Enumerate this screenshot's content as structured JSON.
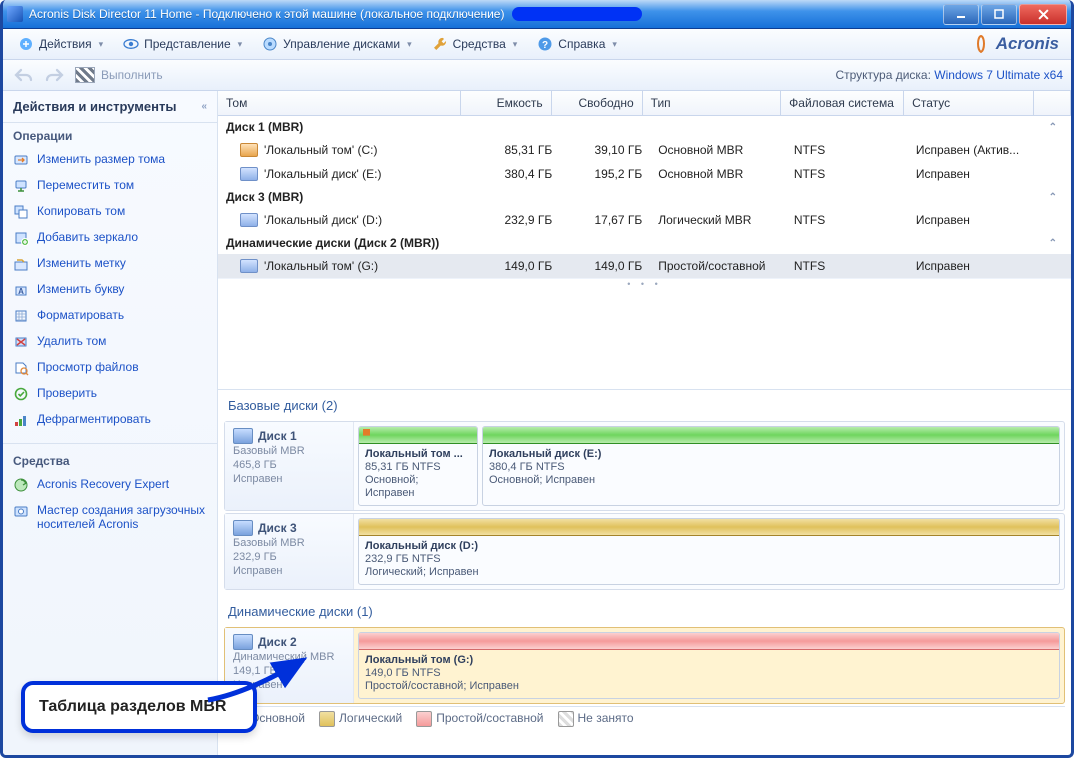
{
  "titlebar": {
    "title": "Acronis Disk Director 11 Home - Подключено к этой машине (локальное подключение)"
  },
  "menu": {
    "actions": "Действия",
    "view": "Представление",
    "diskmgmt": "Управление дисками",
    "tools": "Средства",
    "help": "Справка",
    "brand": "Acronis"
  },
  "toolbar": {
    "run": "Выполнить",
    "struct_label": "Структура диска:",
    "struct_value": "Windows 7 Ultimate x64"
  },
  "sidebar": {
    "title": "Действия и инструменты",
    "sec_ops": "Операции",
    "ops": [
      "Изменить размер тома",
      "Переместить том",
      "Копировать том",
      "Добавить зеркало",
      "Изменить метку",
      "Изменить букву",
      "Форматировать",
      "Удалить том",
      "Просмотр файлов",
      "Проверить",
      "Дефрагментировать"
    ],
    "sec_tools": "Средства",
    "tools": [
      "Acronis Recovery Expert",
      "Мастер создания загрузочных носителей Acronis"
    ]
  },
  "grid": {
    "headers": {
      "tom": "Том",
      "cap": "Емкость",
      "free": "Свободно",
      "type": "Тип",
      "fs": "Файловая система",
      "status": "Статус"
    },
    "groups": [
      {
        "title": "Диск 1 (MBR)",
        "rows": [
          {
            "name": "'Локальный том' (C:)",
            "cap": "85,31 ГБ",
            "free": "39,10 ГБ",
            "type": "Основной MBR",
            "fs": "NTFS",
            "status": "Исправен (Актив...",
            "boot": true
          },
          {
            "name": "'Локальный диск' (E:)",
            "cap": "380,4 ГБ",
            "free": "195,2 ГБ",
            "type": "Основной MBR",
            "fs": "NTFS",
            "status": "Исправен"
          }
        ]
      },
      {
        "title": "Диск 3 (MBR)",
        "rows": [
          {
            "name": "'Локальный диск' (D:)",
            "cap": "232,9 ГБ",
            "free": "17,67 ГБ",
            "type": "Логический MBR",
            "fs": "NTFS",
            "status": "Исправен"
          }
        ]
      },
      {
        "title": "Динамические диски (Диск 2 (MBR))",
        "rows": [
          {
            "name": "'Локальный том' (G:)",
            "cap": "149,0 ГБ",
            "free": "149,0 ГБ",
            "type": "Простой/составной",
            "fs": "NTFS",
            "status": "Исправен",
            "selected": true
          }
        ]
      }
    ]
  },
  "maps": {
    "basic_title": "Базовые диски (2)",
    "dynamic_title": "Динамические диски (1)",
    "disks": [
      {
        "name": "Диск 1",
        "type": "Базовый MBR",
        "size": "465,8 ГБ",
        "state": "Исправен",
        "parts": [
          {
            "name": "Локальный том ...",
            "sub": "85,31 ГБ NTFS",
            "sub2": "Основной; Исправен",
            "color": "green-boot",
            "flex": "0 0 118px"
          },
          {
            "name": "Локальный диск (E:)",
            "sub": "380,4 ГБ NTFS",
            "sub2": "Основной; Исправен",
            "color": "green",
            "flex": "1"
          }
        ]
      },
      {
        "name": "Диск 3",
        "type": "Базовый MBR",
        "size": "232,9 ГБ",
        "state": "Исправен",
        "parts": [
          {
            "name": "Локальный диск  (D:)",
            "sub": "232,9 ГБ NTFS",
            "sub2": "Логический; Исправен",
            "color": "yellow",
            "flex": "1"
          }
        ]
      },
      {
        "name": "Диск 2",
        "type": "Динамический MBR",
        "size": "149,1 ГБ",
        "state": "Исправен",
        "selected": true,
        "parts": [
          {
            "name": "Локальный том (G:)",
            "sub": "149,0 ГБ NTFS",
            "sub2": "Простой/составной; Исправен",
            "color": "pink",
            "flex": "1"
          }
        ]
      }
    ]
  },
  "legend": {
    "primary": "Основной",
    "logical": "Логический",
    "simple": "Простой/составной",
    "free": "Не занято"
  },
  "callout": "Таблица разделов MBR"
}
